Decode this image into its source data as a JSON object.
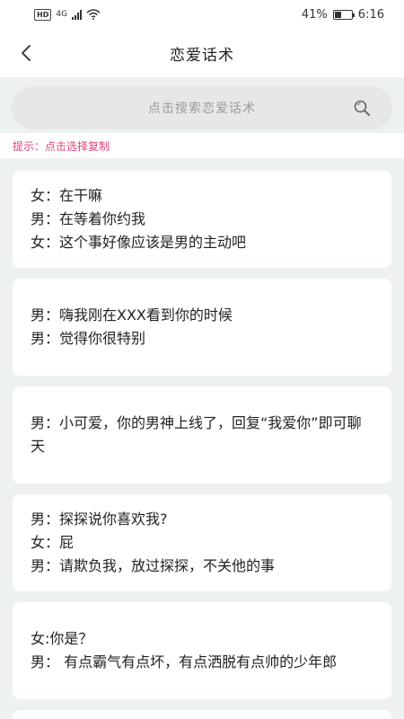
{
  "status_bar": {
    "left_badge": "HD",
    "network": "4G",
    "battery": "41%",
    "battery_level": 0.41,
    "time": "6:16"
  },
  "header": {
    "title": "恋爱话术"
  },
  "search": {
    "placeholder": "点击搜索恋爱话术"
  },
  "hint": "提示：点击选择复制",
  "cards": [
    {
      "lines": [
        "女：在干嘛",
        "男：在等着你约我",
        "女：这个事好像应该是男的主动吧"
      ]
    },
    {
      "lines": [
        "男：嗨我刚在XXX看到你的时候",
        "男：觉得你很特别"
      ]
    },
    {
      "lines": [
        "男：小可爱，你的男神上线了，回复“我爱你”即可聊天"
      ]
    },
    {
      "lines": [
        "男：探探说你喜欢我?",
        "女：屁",
        "男：请欺负我，放过探探，不关他的事"
      ]
    },
    {
      "lines": [
        "女:你是？",
        "男： 有点霸气有点坏，有点洒脱有点帅的少年郎"
      ]
    },
    {
      "lines": []
    }
  ],
  "icons": {
    "back": "chevron-left-icon",
    "search": "search-icon",
    "wifi": "wifi-icon",
    "battery": "battery-icon"
  },
  "colors": {
    "hint_text": "#e0457b",
    "page_bg": "#eef1f1",
    "search_bg": "#e6e8e8"
  }
}
